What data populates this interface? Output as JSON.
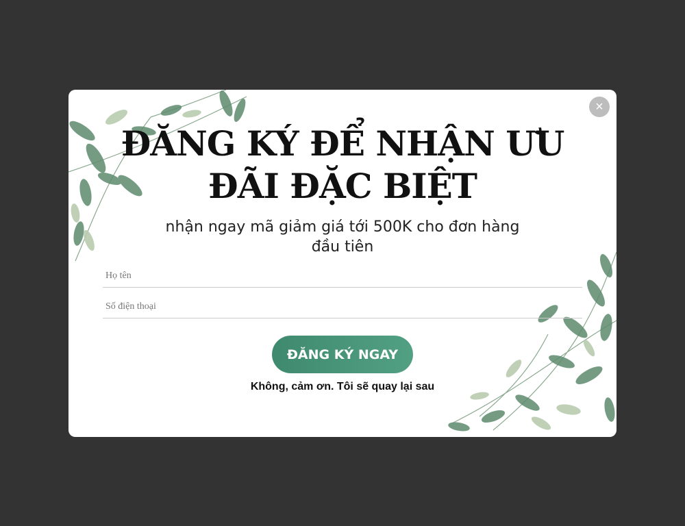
{
  "popup": {
    "title_line1": "ĐĂNG KÝ ĐỂ NHẬN ƯU",
    "title_line2": "ĐÃI ĐẶC BIỆT",
    "subtitle_line1": "nhận ngay mã giảm giá tới 500K cho đơn hàng",
    "subtitle_line2": "đầu tiên",
    "name_placeholder": "Họ tên",
    "phone_placeholder": "Số điện thoại",
    "submit_label": "ĐĂNG KÝ NGAY",
    "decline_label": "Không, cảm ơn. Tôi sẽ quay lại sau",
    "close_symbol": "×"
  },
  "colors": {
    "overlay": "#333333",
    "modal_bg": "#ffffff",
    "button": "#4a967a",
    "leaf": "#6b9a7e"
  },
  "icons": {
    "close": "close-icon",
    "decoration": "leaf-decoration"
  }
}
